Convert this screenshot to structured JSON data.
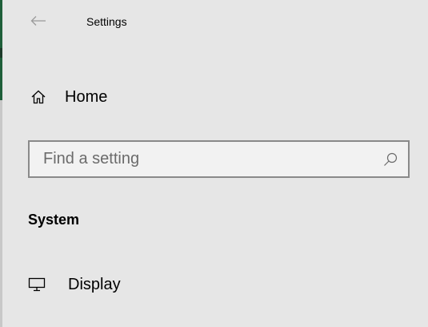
{
  "window": {
    "title": "Settings"
  },
  "nav": {
    "back_icon": "arrow-left-icon",
    "home": {
      "label": "Home",
      "icon": "home-icon"
    },
    "display": {
      "label": "Display",
      "icon": "monitor-icon"
    }
  },
  "search": {
    "value": "",
    "placeholder": "Find a setting",
    "icon": "search-icon"
  },
  "section": {
    "heading": "System"
  },
  "colors": {
    "background": "#e6e6e6",
    "search_border": "#8a8a8a",
    "placeholder": "#6b6b6b",
    "accent_edge": "#1f5f3a"
  }
}
